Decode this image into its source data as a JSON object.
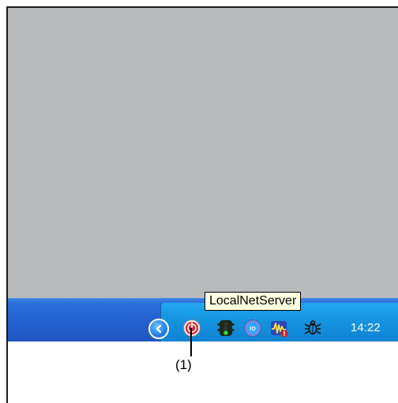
{
  "tooltip": {
    "text": "LocalNetServer"
  },
  "tray": {
    "show_hidden_icons": "show-hidden-icons",
    "icons": [
      {
        "name": "localnetserver-icon"
      },
      {
        "name": "traffic-light-icon"
      },
      {
        "name": "network-io-icon"
      },
      {
        "name": "signal-monitor-icon"
      },
      {
        "name": "bug-icon"
      }
    ],
    "clock": "14:22"
  },
  "callout": {
    "label": "(1)"
  },
  "colors": {
    "desktop": "#b9babc",
    "taskbar": "#2560cf",
    "tray": "#1594e0",
    "tooltip_bg": "#ffffe1"
  }
}
